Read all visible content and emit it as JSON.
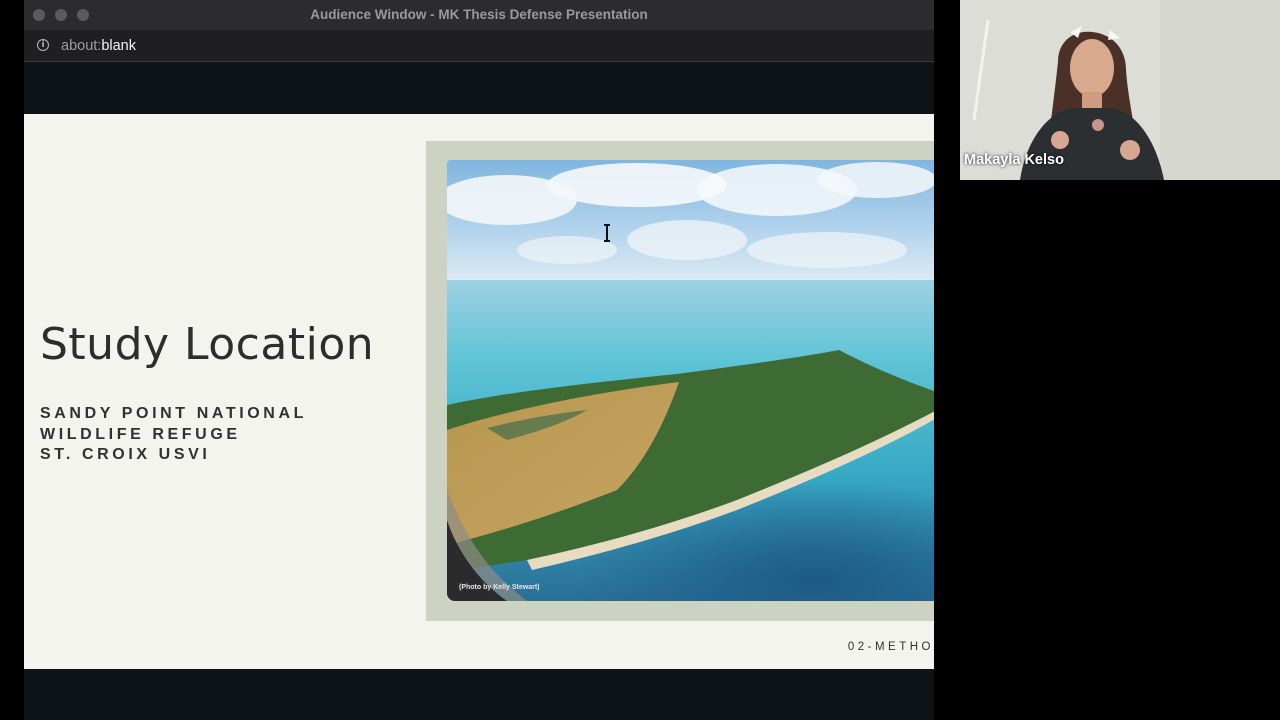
{
  "window": {
    "title": "Audience Window - MK Thesis Defense Presentation",
    "url_scheme": "about:",
    "url_host": "blank"
  },
  "slide": {
    "title": "Study Location",
    "subtitle_lines": [
      "SANDY POINT NATIONAL",
      "WILDLIFE REFUGE",
      "ST. CROIX USVI"
    ],
    "photo_credit": "(Photo by Kelly Stewart)",
    "footer": "02-METHO"
  },
  "participant": {
    "name": "Makayla Kelso"
  },
  "colors": {
    "slide_background": "#f4f4ee",
    "photo_frame": "#cdd3c2",
    "title_text": "#2b2d2e",
    "window_chrome": "#2c2c2e"
  },
  "icons": {
    "site_info": "info-icon",
    "cursor": "text-cursor-icon"
  }
}
